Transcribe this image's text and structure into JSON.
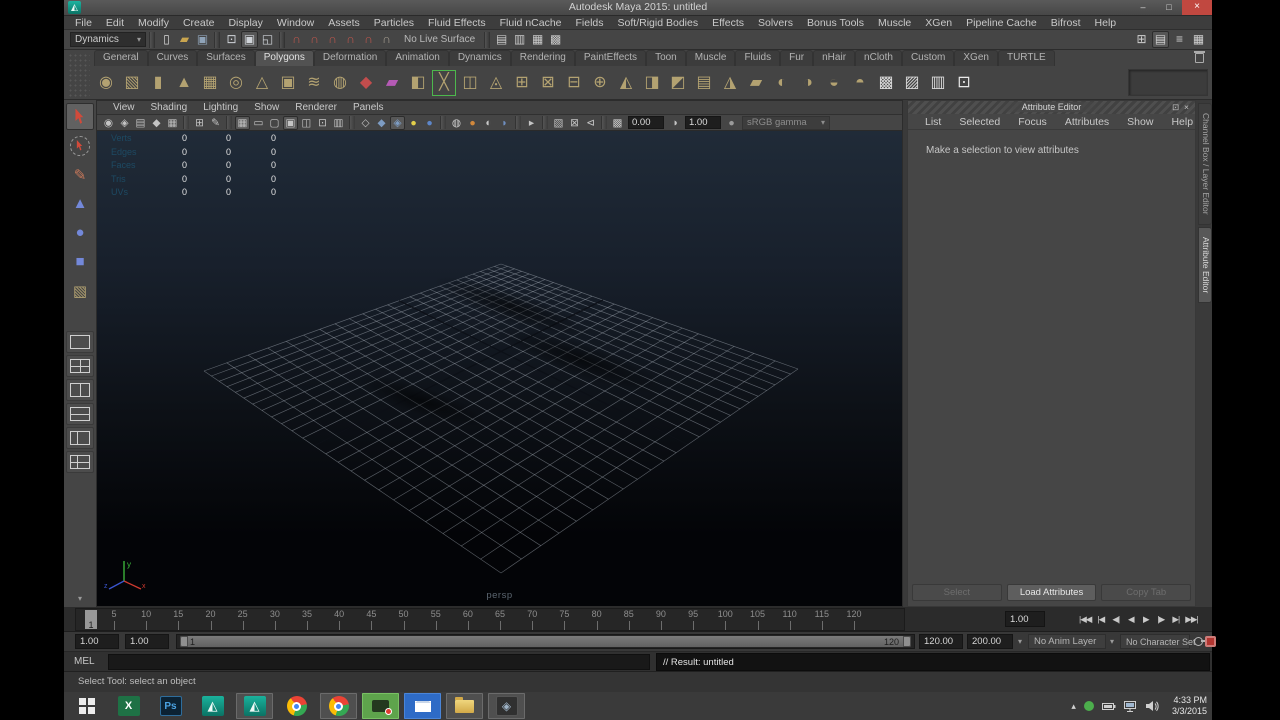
{
  "window": {
    "title": "Autodesk Maya 2015: untitled",
    "controls": {
      "minimize": "–",
      "maximize": "□",
      "close": "×"
    }
  },
  "glyphs": {
    "dropdown_arrow": "▾"
  },
  "colors": {
    "close_button": "#c14840",
    "panel_bg": "#444444",
    "viewport_top": "#202b38",
    "viewport_mid": "#0d1117",
    "viewport_bottom": "#030407",
    "shelf_icon": "#b3a271",
    "snap_icon": "#c2574d",
    "hud_label": "#1d4a63",
    "axis_x": "#d03a2f",
    "axis_y": "#3fbf3f",
    "axis_z": "#3a56d0",
    "taskbar_bg": "#3a3a3a"
  },
  "menu_bar": {
    "items": [
      "File",
      "Edit",
      "Modify",
      "Create",
      "Display",
      "Window",
      "Assets",
      "Particles",
      "Fluid Effects",
      "Fluid nCache",
      "Fields",
      "Soft/Rigid Bodies",
      "Effects",
      "Solvers",
      "Bonus Tools",
      "Muscle",
      "XGen",
      "Pipeline Cache",
      "Bifrost",
      "Help"
    ]
  },
  "status_line": {
    "menu_set": "Dynamics",
    "no_live_surface": "No Live Surface",
    "file_icons": [
      {
        "name": "new-scene-icon",
        "glyph": "▯",
        "color": "#d8d8d8"
      },
      {
        "name": "open-scene-icon",
        "glyph": "▰",
        "color": "#c9a54f"
      },
      {
        "name": "save-scene-icon",
        "glyph": "▣",
        "color": "#8fa3b8"
      }
    ],
    "selection_icons": [
      {
        "name": "select-hierarchy-icon",
        "glyph": "⊡",
        "color": "#cfd3d8"
      },
      {
        "name": "select-object-icon",
        "glyph": "▣",
        "color": "#cfd3d8",
        "pressed": true
      },
      {
        "name": "select-component-icon",
        "glyph": "◱",
        "color": "#cfd3d8"
      }
    ],
    "snap_icons": [
      {
        "name": "snap-to-grids-icon",
        "glyph": "∩",
        "color": "#c2574d"
      },
      {
        "name": "snap-to-curves-icon",
        "glyph": "∩",
        "color": "#c2574d"
      },
      {
        "name": "snap-to-points-icon",
        "glyph": "∩",
        "color": "#c2574d"
      },
      {
        "name": "snap-to-projected-center-icon",
        "glyph": "∩",
        "color": "#c2574d"
      },
      {
        "name": "snap-to-view-planes-icon",
        "glyph": "∩",
        "color": "#c2574d"
      },
      {
        "name": "make-object-live-icon",
        "glyph": "∩",
        "color": "#a89f92"
      }
    ],
    "render_icons": [
      {
        "name": "open-render-view-icon",
        "glyph": "▤",
        "color": "#c9c9c9"
      },
      {
        "name": "render-current-frame-icon",
        "glyph": "▥",
        "color": "#c9c9c9"
      },
      {
        "name": "ipr-render-icon",
        "glyph": "▦",
        "color": "#c9c9c9"
      },
      {
        "name": "render-settings-icon",
        "glyph": "▩",
        "color": "#c9c9c9"
      }
    ],
    "sidebar_icons": [
      {
        "name": "modeling-toolkit-toggle-icon",
        "glyph": "⊞",
        "color": "#cfcfcf"
      },
      {
        "name": "attribute-editor-toggle-icon",
        "glyph": "▤",
        "color": "#cfcfcf",
        "pressed": true
      },
      {
        "name": "tool-settings-toggle-icon",
        "glyph": "≡",
        "color": "#cfcfcf"
      },
      {
        "name": "channel-box-toggle-icon",
        "glyph": "▦",
        "color": "#cfcfcf"
      }
    ]
  },
  "shelf": {
    "active_tab": "Polygons",
    "tabs": [
      "General",
      "Curves",
      "Surfaces",
      "Polygons",
      "Deformation",
      "Animation",
      "Dynamics",
      "Rendering",
      "PaintEffects",
      "Toon",
      "Muscle",
      "Fluids",
      "Fur",
      "nHair",
      "nCloth",
      "Custom",
      "XGen",
      "TURTLE"
    ],
    "icons": [
      {
        "name": "poly-sphere-icon",
        "glyph": "◉"
      },
      {
        "name": "poly-cube-icon",
        "glyph": "▧"
      },
      {
        "name": "poly-cylinder-icon",
        "glyph": "▮"
      },
      {
        "name": "poly-cone-icon",
        "glyph": "▲"
      },
      {
        "name": "poly-plane-icon",
        "glyph": "▦"
      },
      {
        "name": "poly-torus-icon",
        "glyph": "◎"
      },
      {
        "name": "poly-prism-icon",
        "glyph": "△"
      },
      {
        "name": "poly-pipe-icon",
        "glyph": "▣"
      },
      {
        "name": "poly-helix-icon",
        "glyph": "≋"
      },
      {
        "name": "poly-soccer-ball-icon",
        "glyph": "◍"
      },
      {
        "name": "sculpt-tool-icon",
        "glyph": "◆",
        "color": "#c24d4d"
      },
      {
        "name": "poly-type-icon",
        "glyph": "▰",
        "color": "#b55ab5"
      },
      {
        "name": "quad-draw-icon",
        "glyph": "◧"
      },
      {
        "name": "multi-cut-icon",
        "glyph": "╳",
        "frame": true
      },
      {
        "name": "insert-edge-loop-icon",
        "glyph": "◫"
      },
      {
        "name": "offset-edge-loop-icon",
        "glyph": "◬"
      },
      {
        "name": "combine-icon",
        "glyph": "⊞"
      },
      {
        "name": "separate-icon",
        "glyph": "⊠"
      },
      {
        "name": "extract-icon",
        "glyph": "⊟"
      },
      {
        "name": "boolean-union-icon",
        "glyph": "⊕"
      },
      {
        "name": "smooth-icon",
        "glyph": "◭"
      },
      {
        "name": "extrude-icon",
        "glyph": "◨"
      },
      {
        "name": "bevel-icon",
        "glyph": "◩"
      },
      {
        "name": "bridge-icon",
        "glyph": "▤"
      },
      {
        "name": "mirror-geometry-icon",
        "glyph": "◮"
      },
      {
        "name": "crease-tool-icon",
        "glyph": "▰"
      },
      {
        "name": "symmetry-icon",
        "glyph": "◐"
      },
      {
        "name": "average-vertices-icon",
        "glyph": "◑"
      },
      {
        "name": "transfer-attributes-icon",
        "glyph": "◒"
      },
      {
        "name": "paint-transfer-icon",
        "glyph": "◓"
      },
      {
        "name": "checker-bake-icon",
        "glyph": "▩",
        "color": "#d8d8d8"
      },
      {
        "name": "turtle-bake-icon",
        "glyph": "▨",
        "color": "#d8d8d8"
      },
      {
        "name": "turtle-settings-icon",
        "glyph": "▥",
        "color": "#d8d8d8"
      },
      {
        "name": "turtle-render-icon",
        "glyph": "⊡",
        "color": "#e8e8e8"
      }
    ]
  },
  "toolbox": {
    "tools": [
      {
        "name": "select-tool",
        "active": true
      },
      {
        "name": "lasso-select-tool"
      },
      {
        "name": "paint-select-tool",
        "glyph": "✎",
        "color": "#c8785a"
      },
      {
        "name": "move-tool",
        "glyph": "▲",
        "color": "#7388d9"
      },
      {
        "name": "rotate-tool",
        "glyph": "●",
        "color": "#7388d9"
      },
      {
        "name": "scale-tool",
        "glyph": "■",
        "color": "#7388d9"
      },
      {
        "name": "last-tool-used",
        "glyph": "▧",
        "color": "#b3a271"
      }
    ],
    "layouts": [
      {
        "name": "layout-single-pane",
        "lines": []
      },
      {
        "name": "layout-four-pane",
        "lines": [
          "l-v",
          "l-h"
        ]
      },
      {
        "name": "layout-two-pane-side-by-side",
        "lines": [
          "l-v"
        ]
      },
      {
        "name": "layout-two-pane-stacked",
        "lines": [
          "l-h"
        ]
      },
      {
        "name": "layout-three-pane-split",
        "lines": [
          "l-v2"
        ]
      },
      {
        "name": "layout-persp-outliner",
        "lines": [
          "l-v2",
          "l-h"
        ]
      }
    ]
  },
  "panel_menu": {
    "items": [
      "View",
      "Shading",
      "Lighting",
      "Show",
      "Renderer",
      "Panels"
    ]
  },
  "viewport_toolbar": {
    "exposure": "0.00",
    "gamma": "1.00",
    "colorspace": "sRGB gamma",
    "items": [
      {
        "name": "select-camera-icon",
        "glyph": "◉"
      },
      {
        "name": "camera-lock-icon",
        "glyph": "◈"
      },
      {
        "name": "camera-attributes-icon",
        "glyph": "▤"
      },
      {
        "name": "bookmarks-icon",
        "glyph": "◆"
      },
      {
        "name": "image-plane-icon",
        "glyph": "▦"
      },
      {
        "name": "sep"
      },
      {
        "name": "2d-pan-zoom-icon",
        "glyph": "⊞"
      },
      {
        "name": "grease-pencil-icon",
        "glyph": "✎"
      },
      {
        "name": "sep"
      },
      {
        "name": "grid-toggle-icon",
        "glyph": "▦",
        "pressed": true
      },
      {
        "name": "film-gate-icon",
        "glyph": "▭"
      },
      {
        "name": "resolution-gate-icon",
        "glyph": "▢"
      },
      {
        "name": "gate-mask-icon",
        "glyph": "▣",
        "pressed": true
      },
      {
        "name": "field-chart-icon",
        "glyph": "◫"
      },
      {
        "name": "safe-action-icon",
        "glyph": "⊡"
      },
      {
        "name": "safe-title-icon",
        "glyph": "▥"
      },
      {
        "name": "sep"
      },
      {
        "name": "wireframe-mode-icon",
        "glyph": "◇"
      },
      {
        "name": "shaded-mode-icon",
        "glyph": "◆",
        "color": "#7d9cc3"
      },
      {
        "name": "textured-mode-icon",
        "glyph": "◈",
        "color": "#7d9cc3",
        "pressed": true
      },
      {
        "name": "use-all-lights-icon",
        "glyph": "●",
        "color": "#e3cf4a"
      },
      {
        "name": "shadows-icon",
        "glyph": "●",
        "color": "#5d86c9"
      },
      {
        "name": "sep"
      },
      {
        "name": "ambient-occlusion-icon",
        "glyph": "◍",
        "color": "#d0d0d0"
      },
      {
        "name": "motion-blur-icon",
        "glyph": "●",
        "color": "#d1883c"
      },
      {
        "name": "multisample-aa-icon",
        "glyph": "◐",
        "color": "#c8c8c8"
      },
      {
        "name": "depth-of-field-icon",
        "glyph": "◗",
        "color": "#6f8fc0"
      },
      {
        "name": "sep"
      },
      {
        "name": "isolate-select-icon",
        "glyph": "▸"
      },
      {
        "name": "sep"
      },
      {
        "name": "xray-icon",
        "glyph": "▧"
      },
      {
        "name": "xray-joints-icon",
        "glyph": "⊠"
      },
      {
        "name": "plugin-shapes-icon",
        "glyph": "⊲"
      },
      {
        "name": "sep"
      },
      {
        "name": "exposure-icon",
        "glyph": "▩"
      },
      {
        "name": "exposure-field",
        "field": "exposure"
      },
      {
        "name": "gamma-icon",
        "glyph": "◑"
      },
      {
        "name": "gamma-field",
        "field": "gamma"
      },
      {
        "name": "no-color-management-icon",
        "glyph": "●",
        "color": "#9a9a9a"
      },
      {
        "name": "view-transform-select",
        "select": "colorspace"
      }
    ]
  },
  "hud": {
    "camera_label": "persp",
    "axis_labels": {
      "x": "x",
      "y": "y",
      "z": "z"
    },
    "rows": [
      {
        "label": "Verts",
        "values": [
          "0",
          "0",
          "0"
        ]
      },
      {
        "label": "Edges",
        "values": [
          "0",
          "0",
          "0"
        ]
      },
      {
        "label": "Faces",
        "values": [
          "0",
          "0",
          "0"
        ]
      },
      {
        "label": "Tris",
        "values": [
          "0",
          "0",
          "0"
        ]
      },
      {
        "label": "UVs",
        "values": [
          "0",
          "0",
          "0"
        ]
      }
    ]
  },
  "attribute_editor": {
    "title": "Attribute Editor",
    "controls": {
      "undock": "⊡",
      "close": "×"
    },
    "menus": [
      "List",
      "Selected",
      "Focus",
      "Attributes",
      "Show",
      "Help"
    ],
    "message": "Make a selection to view attributes",
    "buttons": [
      {
        "label": "Select",
        "enabled": false
      },
      {
        "label": "Load Attributes",
        "enabled": true
      },
      {
        "label": "Copy Tab",
        "enabled": false
      }
    ]
  },
  "side_tabs": [
    {
      "label": "Channel Box / Layer Editor",
      "active": false
    },
    {
      "label": "Attribute Editor",
      "active": true
    }
  ],
  "timeline": {
    "current_frame": "1",
    "current_time": "1.00",
    "ticks": [
      5,
      10,
      15,
      20,
      25,
      30,
      35,
      40,
      45,
      50,
      55,
      60,
      65,
      70,
      75,
      80,
      85,
      90,
      95,
      100,
      105,
      110,
      115,
      120
    ]
  },
  "playback": {
    "buttons": [
      {
        "name": "go-to-start-button",
        "glyph": "|◀◀"
      },
      {
        "name": "step-back-frame-button",
        "glyph": "|◀"
      },
      {
        "name": "step-back-key-button",
        "glyph": "◀|"
      },
      {
        "name": "play-backwards-button",
        "glyph": "◀"
      },
      {
        "name": "play-forwards-button",
        "glyph": "▶"
      },
      {
        "name": "step-forward-key-button",
        "glyph": "|▶"
      },
      {
        "name": "step-forward-frame-button",
        "glyph": "▶|"
      },
      {
        "name": "go-to-end-button",
        "glyph": "▶▶|"
      }
    ]
  },
  "range_slider": {
    "anim_start": "1.00",
    "playback_start": "1.00",
    "bar_start": "1",
    "bar_end": "120",
    "playback_end": "120.00",
    "anim_end": "200.00",
    "anim_layer": "No Anim Layer",
    "character_set": "No Character Set"
  },
  "command_line": {
    "label": "MEL",
    "result": "// Result: untitled"
  },
  "help_line": {
    "text": "Select Tool: select an object"
  },
  "taskbar": {
    "tray_time": "4:33 PM",
    "tray_date": "3/3/2015",
    "items": [
      {
        "name": "start-button",
        "type": "start"
      },
      {
        "name": "excel-taskbar-icon",
        "type": "excel",
        "label": "X"
      },
      {
        "name": "photoshop-taskbar-icon",
        "type": "ps",
        "label": "Ps"
      },
      {
        "name": "maya-taskbar-icon",
        "type": "maya",
        "glyph": "◭"
      },
      {
        "name": "maya-taskbar-icon-active",
        "type": "maya",
        "glyph": "◭",
        "pressed": true
      },
      {
        "name": "chrome-taskbar-icon",
        "type": "chrome"
      },
      {
        "name": "chrome-taskbar-icon-active",
        "type": "chrome",
        "pressed": true
      },
      {
        "name": "screen-recorder-taskbar-icon",
        "type": "recorder"
      },
      {
        "name": "mail-taskbar-icon",
        "type": "mail"
      },
      {
        "name": "file-explorer-taskbar-icon",
        "type": "folder",
        "pressed": true
      },
      {
        "name": "photo-viewer-taskbar-icon",
        "type": "photos",
        "glyph": "◈",
        "pressed": true
      }
    ],
    "tray_icons": [
      {
        "name": "hidden-icons-chevron",
        "type": "chevron",
        "glyph": "▴"
      },
      {
        "name": "recorder-tray-icon",
        "type": "green-dot"
      },
      {
        "name": "battery-icon",
        "type": "battery"
      },
      {
        "name": "network-icon",
        "type": "network"
      },
      {
        "name": "volume-icon",
        "type": "volume"
      }
    ]
  }
}
